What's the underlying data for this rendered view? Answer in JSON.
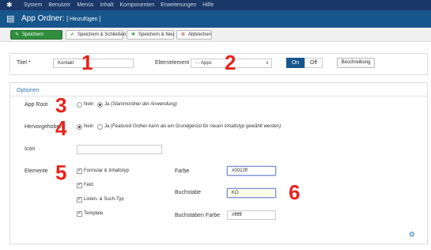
{
  "topnav": {
    "items": [
      "System",
      "Benutzer",
      "Menüs",
      "Inhalt",
      "Komponenten",
      "Erweiterungen",
      "Hilfe"
    ]
  },
  "header": {
    "title": "App Ordner:",
    "subtitle": "[ Hinzufügen ]"
  },
  "toolbar": {
    "save": "Speichern",
    "save_close": "Speichern & Schließen",
    "save_new": "Speichern & Neu",
    "cancel": "Abbrechen"
  },
  "form": {
    "title_label": "Titel *",
    "title_value": "Kontakt",
    "parent_label": "Elternelement",
    "parent_value": "- - Apps",
    "toggle_on": "On",
    "toggle_off": "Off",
    "description_button": "Beschreibung"
  },
  "options": {
    "tab": "Optionen",
    "app_root_label": "App Root",
    "app_root_no": "Nein",
    "app_root_yes": "Ja",
    "app_root_yes_note": "(Stammordner der Anwendung)",
    "featured_label": "Hervorgehoben",
    "featured_no": "Nein",
    "featured_yes": "Ja",
    "featured_yes_note": "(Featured Ordner kann als ein Grundgerüst für neuen Inhaltstyp gewählt werden)",
    "icon_label": "Icon",
    "icon_value": "",
    "elements_label": "Elemente",
    "elements": [
      "Formular & Inhaltstyp",
      "Feld",
      "Listen- & Such-Typ",
      "Template"
    ],
    "color_label": "Farbe",
    "color_value": "#0022ff",
    "letter_label": "Buchstabe",
    "letter_value": "KO",
    "letter_color_label": "Buchstaben Farbe",
    "letter_color_value": "#ffffff"
  },
  "annotations": [
    "1",
    "2",
    "3",
    "4",
    "5",
    "6"
  ],
  "colors": {
    "topnav": "#1a3867",
    "titlebar": "#17568c",
    "save_button": "#2f8d3b",
    "annotation": "#e8231a",
    "tab_title": "#2a7ab8"
  }
}
